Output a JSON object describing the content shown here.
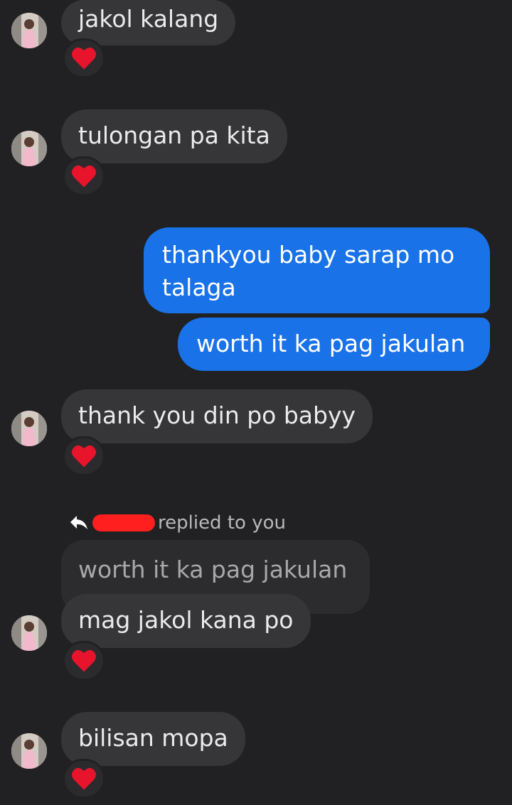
{
  "messages": [
    {
      "text": "jakol kalang",
      "direction": "incoming",
      "reaction": "heart"
    },
    {
      "text": "tulongan pa kita",
      "direction": "incoming",
      "reaction": "heart"
    },
    {
      "text_lines": [
        "thankyou baby sarap mo",
        "talaga"
      ],
      "direction": "outgoing"
    },
    {
      "text": "worth it ka pag jakulan",
      "direction": "outgoing"
    },
    {
      "text": "thank you din po babyy",
      "direction": "incoming",
      "reaction": "heart"
    },
    {
      "reply": {
        "label": "replied to you",
        "quoted_text": "worth it ka pag jakulan"
      },
      "text": "mag jakol kana po",
      "direction": "incoming",
      "reaction": "heart"
    },
    {
      "text": "bilisan mopa",
      "direction": "incoming",
      "reaction": "heart"
    }
  ],
  "colors": {
    "background": "#212123",
    "incoming_bubble": "#363638",
    "outgoing_bubble": "#1a72e8",
    "heart": "#e8142c",
    "redaction": "#ff1f1f"
  },
  "icons": {
    "reaction": "heart-icon",
    "reply": "reply-arrow-icon"
  }
}
